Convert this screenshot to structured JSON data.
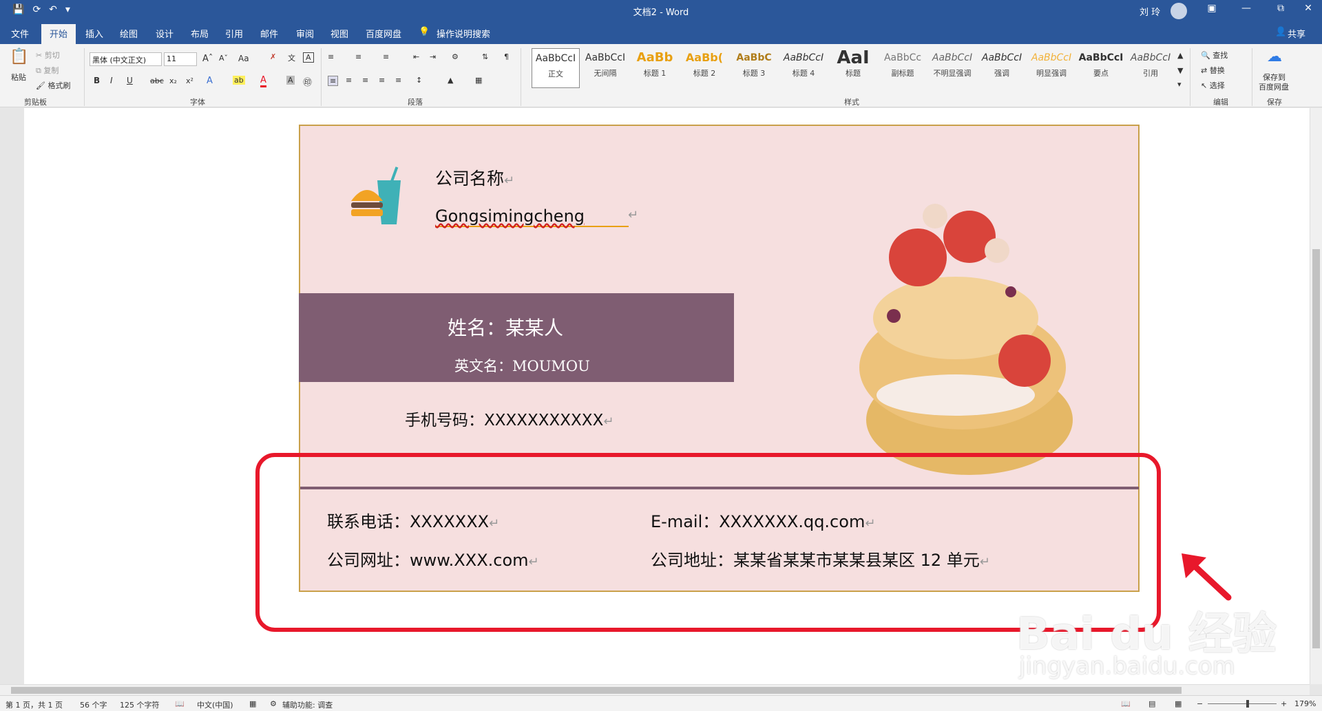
{
  "titlebar": {
    "doc_title": "文档2  -  Word",
    "user": "刘 玲",
    "colors": {
      "bar": "#2b579a"
    }
  },
  "tabs": [
    "文件",
    "开始",
    "插入",
    "绘图",
    "设计",
    "布局",
    "引用",
    "邮件",
    "审阅",
    "视图",
    "百度网盘",
    "操作说明搜索"
  ],
  "share_label": "共享",
  "clipboard": {
    "paste": "粘贴",
    "cut": "剪切",
    "copy": "复制",
    "format_painter": "格式刷",
    "group": "剪贴板"
  },
  "font": {
    "name": "黑体 (中文正文)",
    "size": "11",
    "group": "字体",
    "case": "Aa",
    "bold": "B",
    "italic": "I",
    "underline": "U",
    "strike": "abc",
    "sub": "x₂",
    "sup": "x²"
  },
  "paragraph": {
    "group": "段落"
  },
  "styles": {
    "group": "样式",
    "items": [
      {
        "sample": "AaBbCcI",
        "label": "正文"
      },
      {
        "sample": "AaBbCcI",
        "label": "无间隔"
      },
      {
        "sample": "AaBb",
        "label": "标题 1"
      },
      {
        "sample": "AaBb(",
        "label": "标题 2"
      },
      {
        "sample": "AaBbC",
        "label": "标题 3"
      },
      {
        "sample": "AaBbCcI",
        "label": "标题 4"
      },
      {
        "sample": "AaI",
        "label": "标题"
      },
      {
        "sample": "AaBbCc",
        "label": "副标题"
      },
      {
        "sample": "AaBbCcI",
        "label": "不明显强调"
      },
      {
        "sample": "AaBbCcI",
        "label": "强调"
      },
      {
        "sample": "AaBbCcI",
        "label": "明显强调"
      },
      {
        "sample": "AaBbCcI",
        "label": "要点"
      },
      {
        "sample": "AaBbCcI",
        "label": "引用"
      }
    ]
  },
  "editing": {
    "find": "查找",
    "replace": "替换",
    "select": "选择",
    "group": "编辑"
  },
  "save": {
    "label1": "保存到",
    "label2": "百度网盘",
    "group": "保存"
  },
  "card": {
    "company_cn": "公司名称",
    "company_en": "Gongsimingcheng",
    "name": "姓名：某某人",
    "english_name": "英文名：MOUMOU",
    "mobile": "手机号码：XXXXXXXXXXX",
    "phone": "联系电话：XXXXXXX",
    "email": "E-mail：XXXXXXX.qq.com",
    "website": "公司网址：www.XXX.com",
    "address": "公司地址：某某省某某市某某县某区 12 单元",
    "colors": {
      "background": "#f6dfdf",
      "band": "#7f5d72",
      "border": "#c9a04a"
    }
  },
  "annotation": {
    "color": "#e8182b"
  },
  "statusbar": {
    "page": "第 1 页，共 1 页",
    "words": "56 个字",
    "chars": "125 个字符",
    "lang": "中文(中国)",
    "accessibility": "辅助功能: 调查",
    "zoom": "179%"
  },
  "watermark": {
    "brand": "Bai du 经验",
    "url": "jingyan.baidu.com"
  }
}
